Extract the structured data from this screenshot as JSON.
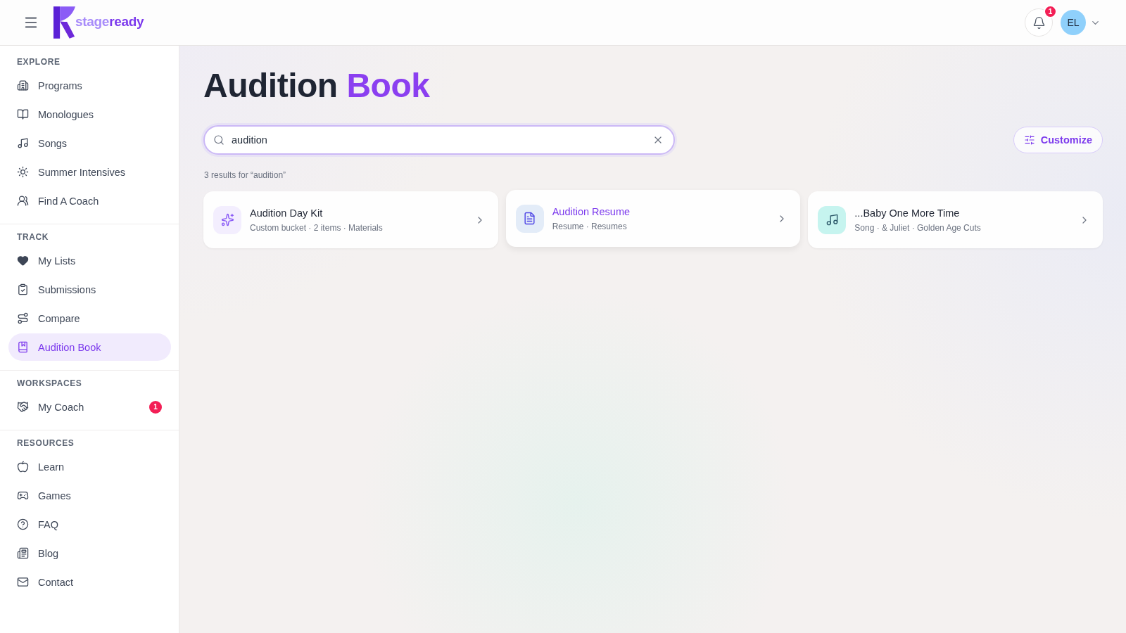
{
  "header": {
    "logo": {
      "light": "stage",
      "strong": "ready"
    },
    "notifications": {
      "badge": "1"
    },
    "avatar": {
      "initials": "EL"
    }
  },
  "sidebar": {
    "sections": [
      {
        "label": "EXPLORE",
        "items": [
          {
            "label": "Programs",
            "selected": false
          },
          {
            "label": "Monologues",
            "selected": false
          },
          {
            "label": "Songs",
            "selected": false
          },
          {
            "label": "Summer Intensives",
            "selected": false
          },
          {
            "label": "Find A Coach",
            "selected": false
          }
        ]
      },
      {
        "label": "TRACK",
        "items": [
          {
            "label": "My Lists",
            "selected": false
          },
          {
            "label": "Submissions",
            "selected": false
          },
          {
            "label": "Compare",
            "selected": false
          },
          {
            "label": "Audition Book",
            "selected": true
          }
        ]
      },
      {
        "label": "WORKSPACES",
        "items": [
          {
            "label": "My Coach",
            "selected": false,
            "badge": "1"
          }
        ]
      },
      {
        "label": "RESOURCES",
        "items": [
          {
            "label": "Learn",
            "selected": false
          },
          {
            "label": "Games",
            "selected": false
          },
          {
            "label": "FAQ",
            "selected": false
          },
          {
            "label": "Blog",
            "selected": false
          },
          {
            "label": "Contact",
            "selected": false
          }
        ]
      }
    ]
  },
  "main": {
    "title": [
      {
        "text": "Audition",
        "accent": false
      },
      {
        "text": "Book",
        "accent": true
      }
    ],
    "search": {
      "value": "audition"
    },
    "customize_button": {
      "label": "Customize"
    },
    "results_summary": "3 results for “audition”",
    "results": [
      {
        "kind": "bucket",
        "title": "Audition Day Kit",
        "subtitle": "Custom bucket · 2 items · Materials",
        "selected": false
      },
      {
        "kind": "resume",
        "title": "Audition Resume",
        "subtitle": "Resume · Resumes",
        "selected": true
      },
      {
        "kind": "song",
        "title": "...Baby One More Time",
        "subtitle": "Song · & Juliet · Golden Age Cuts",
        "selected": false
      }
    ]
  }
}
